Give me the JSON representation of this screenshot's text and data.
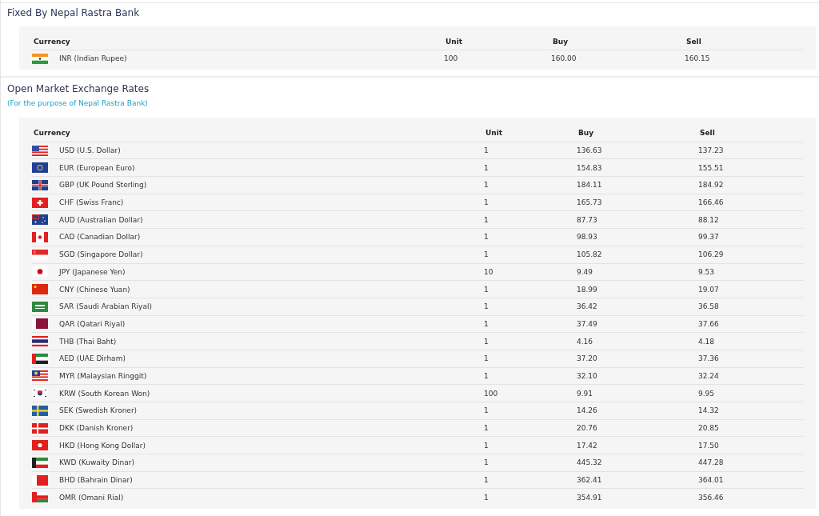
{
  "fixed": {
    "title": "Fixed By Nepal Rastra Bank",
    "columns": [
      "Currency",
      "Unit",
      "Buy",
      "Sell"
    ],
    "rows": [
      {
        "currency": "INR (Indian Rupee)",
        "unit": "100",
        "buy": "160.00",
        "sell": "160.15"
      }
    ]
  },
  "open_market": {
    "title": "Open Market Exchange Rates",
    "subtitle": "(For the purpose of Nepal Rastra Bank)",
    "columns": [
      "Currency",
      "Unit",
      "Buy",
      "Sell"
    ],
    "rows": [
      {
        "currency": "USD (U.S. Dollar)",
        "unit": "1",
        "buy": "136.63",
        "sell": "137.23"
      },
      {
        "currency": "EUR (European Euro)",
        "unit": "1",
        "buy": "154.83",
        "sell": "155.51"
      },
      {
        "currency": "GBP (UK Pound Sterling)",
        "unit": "1",
        "buy": "184.11",
        "sell": "184.92"
      },
      {
        "currency": "CHF (Swiss Franc)",
        "unit": "1",
        "buy": "165.73",
        "sell": "166.46"
      },
      {
        "currency": "AUD (Australian Dollar)",
        "unit": "1",
        "buy": "87.73",
        "sell": "88.12"
      },
      {
        "currency": "CAD (Canadian Dollar)",
        "unit": "1",
        "buy": "98.93",
        "sell": "99.37"
      },
      {
        "currency": "SGD (Singapore Dollar)",
        "unit": "1",
        "buy": "105.82",
        "sell": "106.29"
      },
      {
        "currency": "JPY (Japanese Yen)",
        "unit": "10",
        "buy": "9.49",
        "sell": "9.53"
      },
      {
        "currency": "CNY (Chinese Yuan)",
        "unit": "1",
        "buy": "18.99",
        "sell": "19.07"
      },
      {
        "currency": "SAR (Saudi Arabian Riyal)",
        "unit": "1",
        "buy": "36.42",
        "sell": "36.58"
      },
      {
        "currency": "QAR (Qatari Riyal)",
        "unit": "1",
        "buy": "37.49",
        "sell": "37.66"
      },
      {
        "currency": "THB (Thai Baht)",
        "unit": "1",
        "buy": "4.16",
        "sell": "4.18"
      },
      {
        "currency": "AED (UAE Dirham)",
        "unit": "1",
        "buy": "37.20",
        "sell": "37.36"
      },
      {
        "currency": "MYR (Malaysian Ringgit)",
        "unit": "1",
        "buy": "32.10",
        "sell": "32.24"
      },
      {
        "currency": "KRW (South Korean Won)",
        "unit": "100",
        "buy": "9.91",
        "sell": "9.95"
      },
      {
        "currency": "SEK (Swedish Kroner)",
        "unit": "1",
        "buy": "14.26",
        "sell": "14.32"
      },
      {
        "currency": "DKK (Danish Kroner)",
        "unit": "1",
        "buy": "20.76",
        "sell": "20.85"
      },
      {
        "currency": "HKD (Hong Kong Dollar)",
        "unit": "1",
        "buy": "17.42",
        "sell": "17.50"
      },
      {
        "currency": "KWD (Kuwaity Dinar)",
        "unit": "1",
        "buy": "445.32",
        "sell": "447.28"
      },
      {
        "currency": "BHD (Bahrain Dinar)",
        "unit": "1",
        "buy": "362.41",
        "sell": "364.01"
      },
      {
        "currency": "OMR (Omani Rial)",
        "unit": "1",
        "buy": "354.91",
        "sell": "356.46"
      }
    ]
  }
}
